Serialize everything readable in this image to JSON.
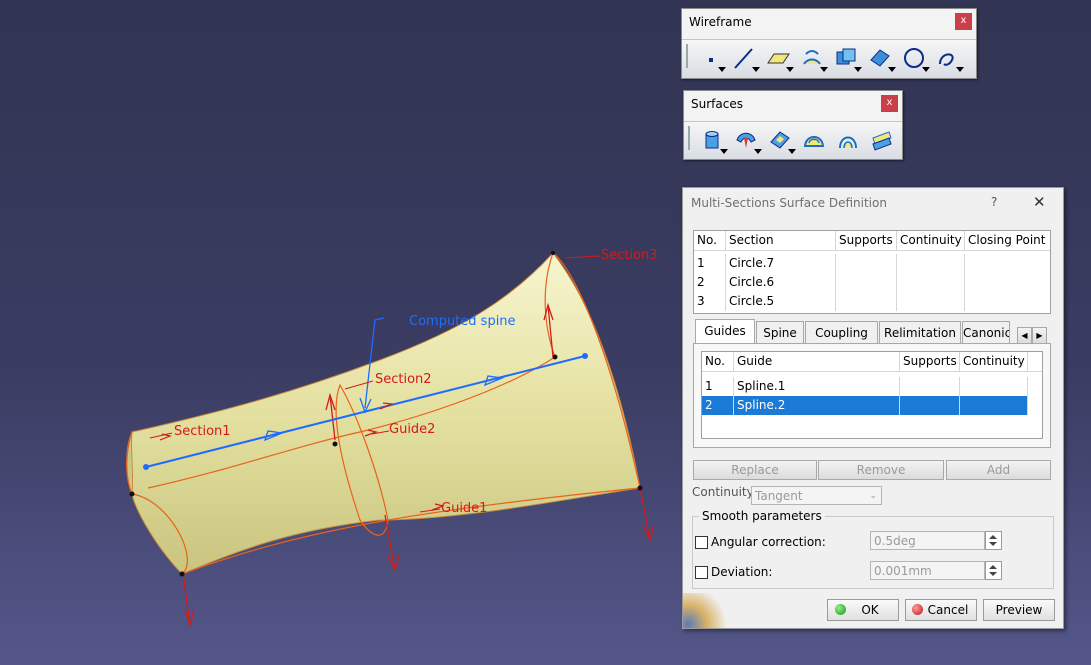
{
  "viewport": {
    "labels": {
      "section1": "Section1",
      "section2": "Section2",
      "section3": "Section3",
      "guide1": "Guide1",
      "guide2": "Guide2",
      "computed_spine": "Computed spine"
    },
    "colors": {
      "surface": "#e6e3a4",
      "guides": "#e8621c",
      "markers": "#d41a1a",
      "spine": "#1e6cff"
    }
  },
  "wireframe_toolbar": {
    "title": "Wireframe",
    "close": "x",
    "icons": [
      "point-icon",
      "line-icon",
      "plane-icon",
      "projection-icon",
      "intersection-icon",
      "offset-icon",
      "circle-icon",
      "spline-icon"
    ]
  },
  "surfaces_toolbar": {
    "title": "Surfaces",
    "close": "x",
    "icons": [
      "extrude-icon",
      "sweep-icon",
      "fill-icon",
      "multi-sections-icon",
      "blend-icon",
      "offset-surface-icon"
    ]
  },
  "dialog": {
    "title": "Multi-Sections Surface Definition",
    "help": "?",
    "close": "✕",
    "sections_table": {
      "columns": [
        "No.",
        "Section",
        "Supports",
        "Continuity",
        "Closing Point"
      ],
      "rows": [
        [
          "1",
          "Circle.7",
          "",
          "",
          ""
        ],
        [
          "2",
          "Circle.6",
          "",
          "",
          ""
        ],
        [
          "3",
          "Circle.5",
          "",
          "",
          ""
        ]
      ]
    },
    "tabs": [
      "Guides",
      "Spine",
      "Coupling",
      "Relimitation",
      "Canonic"
    ],
    "active_tab": "Guides",
    "guides_table": {
      "columns": [
        "No.",
        "Guide",
        "Supports",
        "Continuity"
      ],
      "rows": [
        [
          "1",
          "Spline.1",
          "",
          ""
        ],
        [
          "2",
          "Spline.2",
          "",
          ""
        ]
      ],
      "selected_row": 2
    },
    "buttons": {
      "replace": "Replace",
      "remove": "Remove",
      "add": "Add"
    },
    "continuity": {
      "label": "Continuity:",
      "value": "Tangent"
    },
    "smooth": {
      "title": "Smooth parameters",
      "angular": {
        "label": "Angular correction:",
        "value": "0.5deg",
        "checked": false
      },
      "deviation": {
        "label": "Deviation:",
        "value": "0.001mm",
        "checked": false
      }
    },
    "actions": {
      "ok": "OK",
      "cancel": "Cancel",
      "preview": "Preview"
    }
  }
}
